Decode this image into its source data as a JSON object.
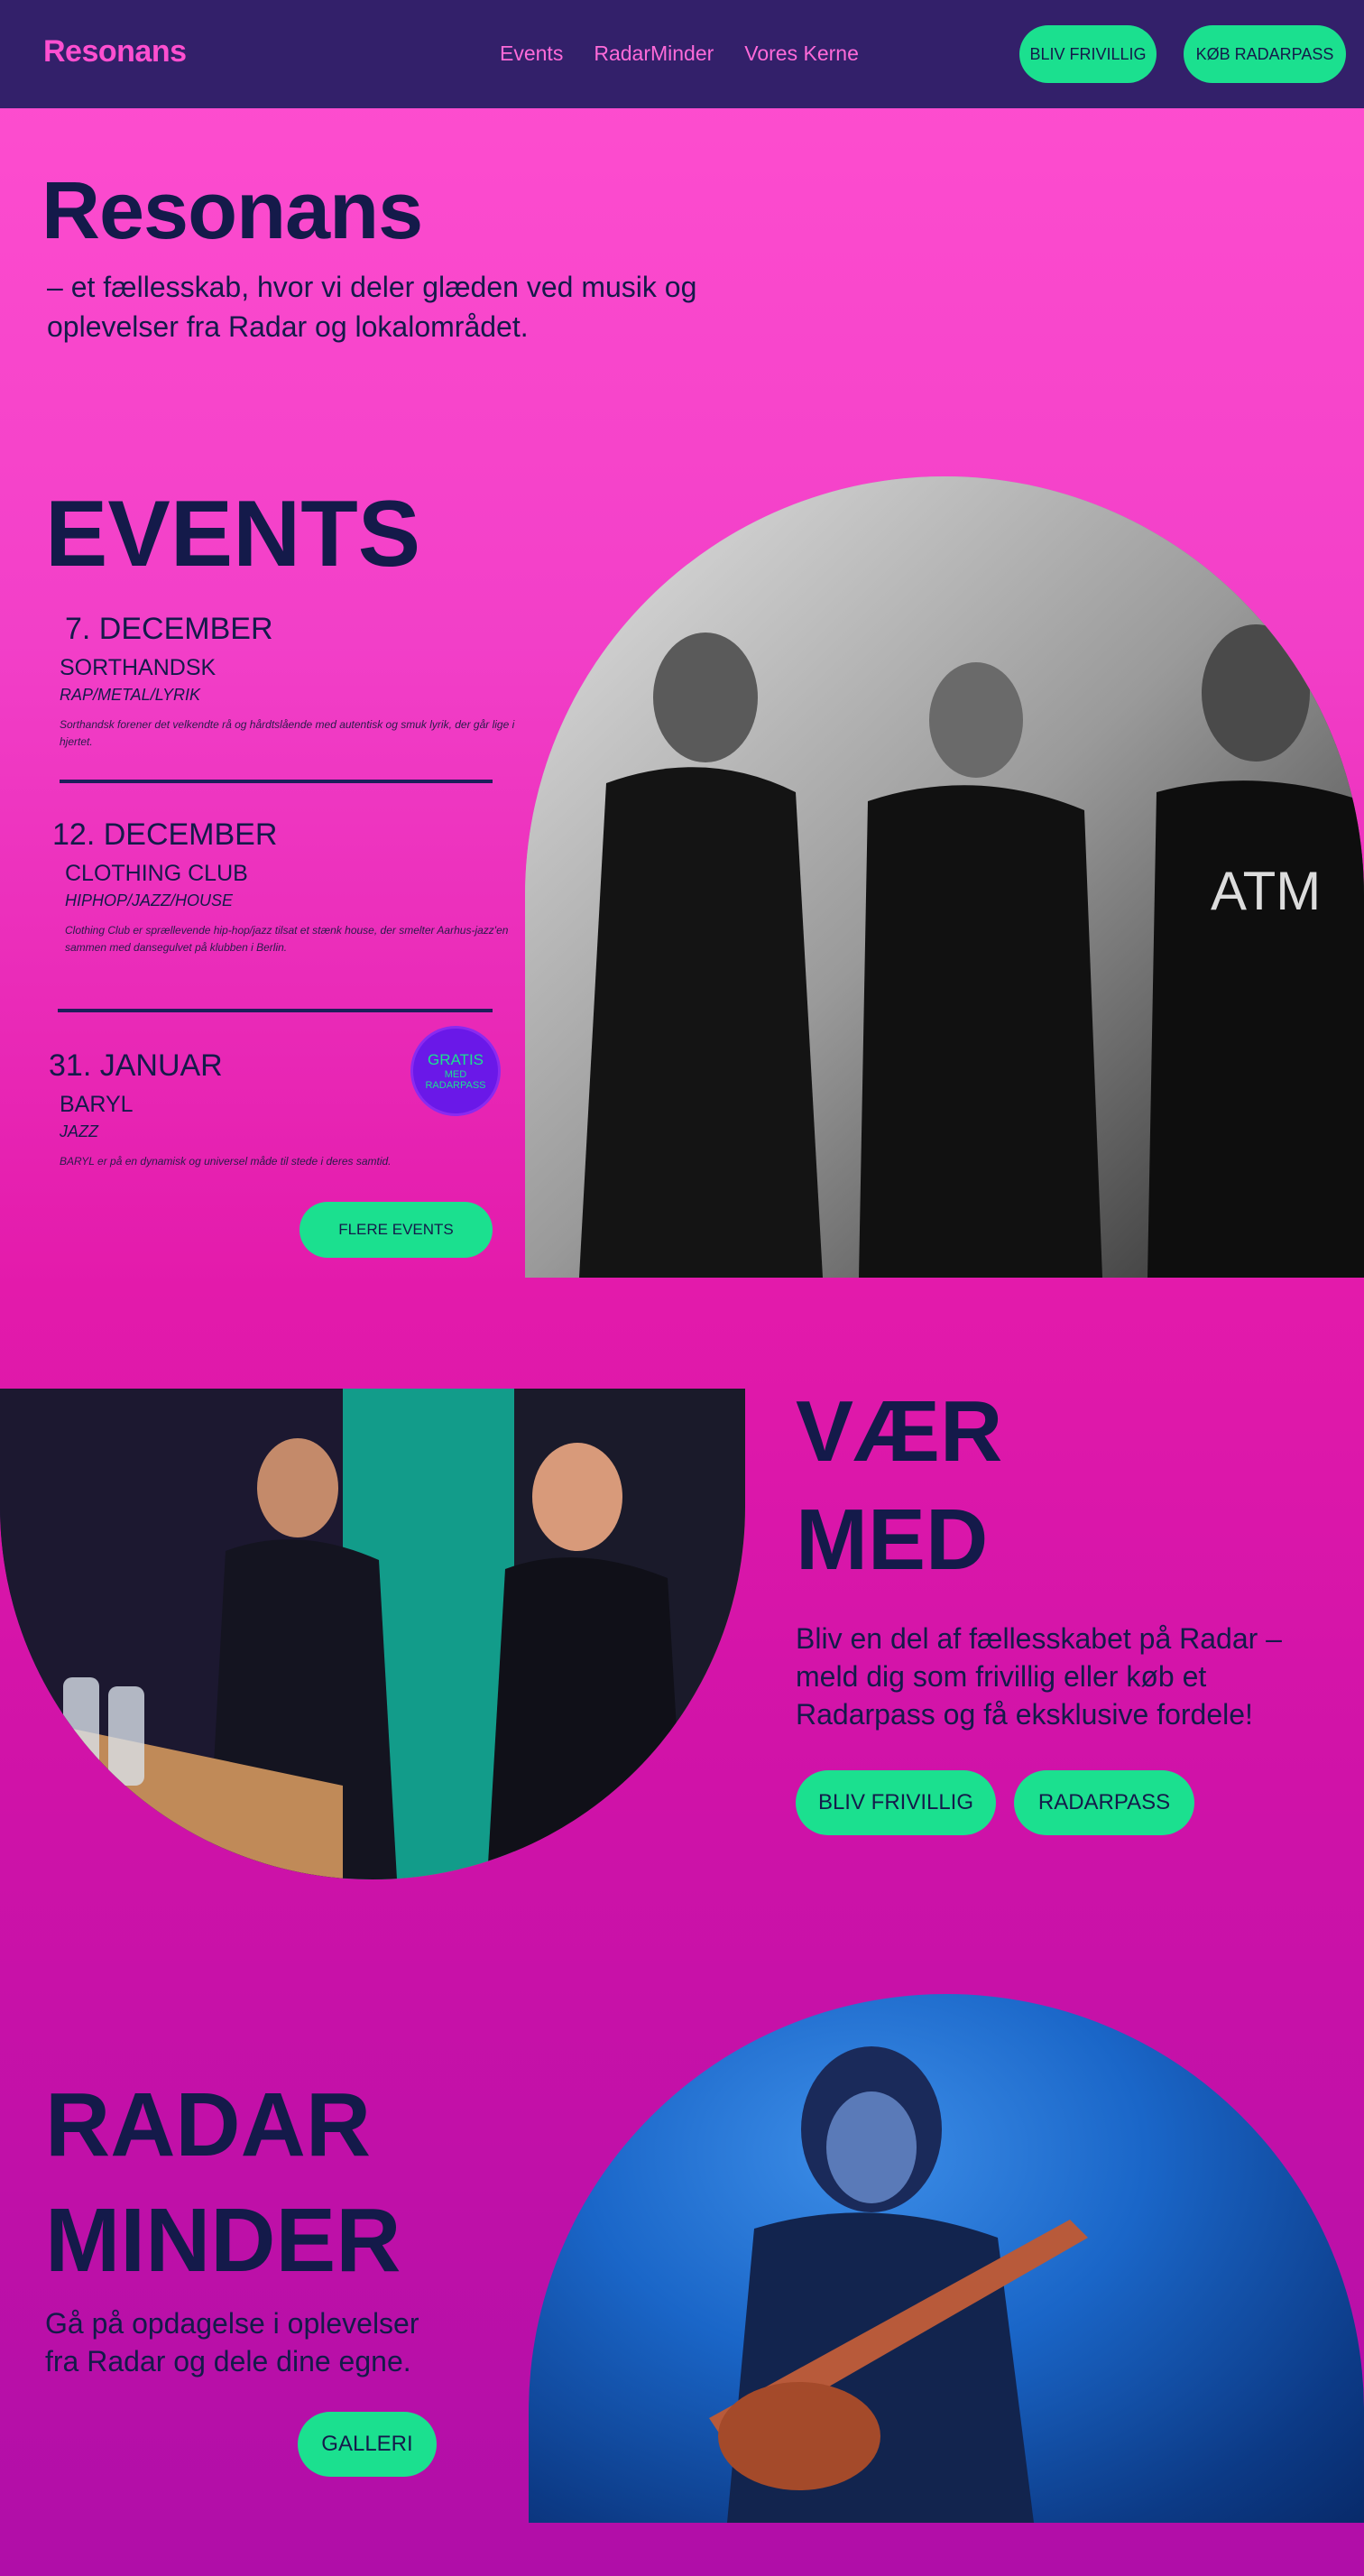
{
  "nav": {
    "logo": "Resonans",
    "links": [
      "Events",
      "RadarMinder",
      "Vores Kerne"
    ],
    "volunteer_button": "BLIV FRIVILLIG",
    "buy_button": "KØB RADARPASS"
  },
  "hero": {
    "logo": "Resonans",
    "tagline": "– et fællesskab, hvor vi deler glæden ved musik og oplevelser fra Radar og lokalområdet."
  },
  "events": {
    "heading": "EVENTS",
    "items": [
      {
        "date": "7. DECEMBER",
        "name": "SORTHANDSK",
        "genre": "RAP/METAL/LYRIK",
        "description": "Sorthandsk forener det velkendte rå og hårdtslående med autentisk og smuk lyrik, der går lige i hjertet."
      },
      {
        "date": "12. DECEMBER",
        "name": "CLOTHING CLUB",
        "genre": "HIPHOP/JAZZ/HOUSE",
        "description": "Clothing Club er sprællevende hip-hop/jazz tilsat et stænk house, der smelter Aarhus-jazz'en sammen med dansegulvet på klubben i Berlin."
      },
      {
        "date": "31. JANUAR",
        "name": "BARYL",
        "genre": "JAZZ",
        "description": "BARYL er på en dynamisk og universel måde til stede i deres samtid."
      }
    ],
    "badge_line1": "GRATIS",
    "badge_line2": "MED RADARPASS",
    "more_button": "FLERE EVENTS"
  },
  "join": {
    "heading_line1": "VÆR",
    "heading_line2": "MED",
    "text": "Bliv en del af fællesskabet på Radar – meld dig som frivillig eller køb et Radarpass og få eksklusive fordele!",
    "volunteer_button": "BLIV FRIVILLIG",
    "pass_button": "RADARPASS"
  },
  "memories": {
    "heading_line1": "RADAR",
    "heading_line2": "MINDER",
    "text": "Gå på opdagelse i oplevelser fra Radar og dele dine egne.",
    "gallery_button": "GALLERI"
  },
  "colors": {
    "nav_bg": "#33206a",
    "accent": "#1be08f",
    "pink": "#ff4fd0",
    "navy": "#141a4a"
  }
}
